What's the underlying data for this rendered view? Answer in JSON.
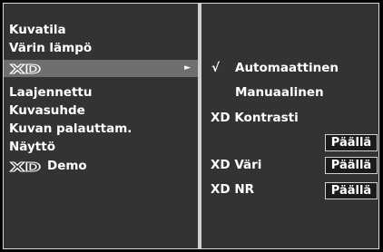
{
  "left_menu": {
    "items": [
      {
        "label": "Kuvatila"
      },
      {
        "label": "Värin lämpö"
      },
      {
        "label": "XD",
        "selected": true
      },
      {
        "label": "Laajennettu"
      },
      {
        "label": "Kuvasuhde"
      },
      {
        "label": "Kuvan palauttam."
      },
      {
        "label": "Näyttö"
      },
      {
        "label": "Demo"
      }
    ],
    "xd_logo": "XD",
    "submenu_arrow": "►"
  },
  "submenu": {
    "check_symbol": "√",
    "automatic_label": "Automaattinen",
    "manual_label": "Manuaalinen",
    "xd_contrast_label": "XD Kontrasti",
    "xd_contrast_value": "Päällä",
    "xd_color_label": "XD Väri",
    "xd_color_value": "Päällä",
    "xd_nr_label": "XD NR",
    "xd_nr_value": "Päällä"
  },
  "colors": {
    "panel_background": "#333333",
    "selected_row": "#6f6f6f",
    "divider": "#cfcfcf",
    "text": "#ffffff"
  }
}
